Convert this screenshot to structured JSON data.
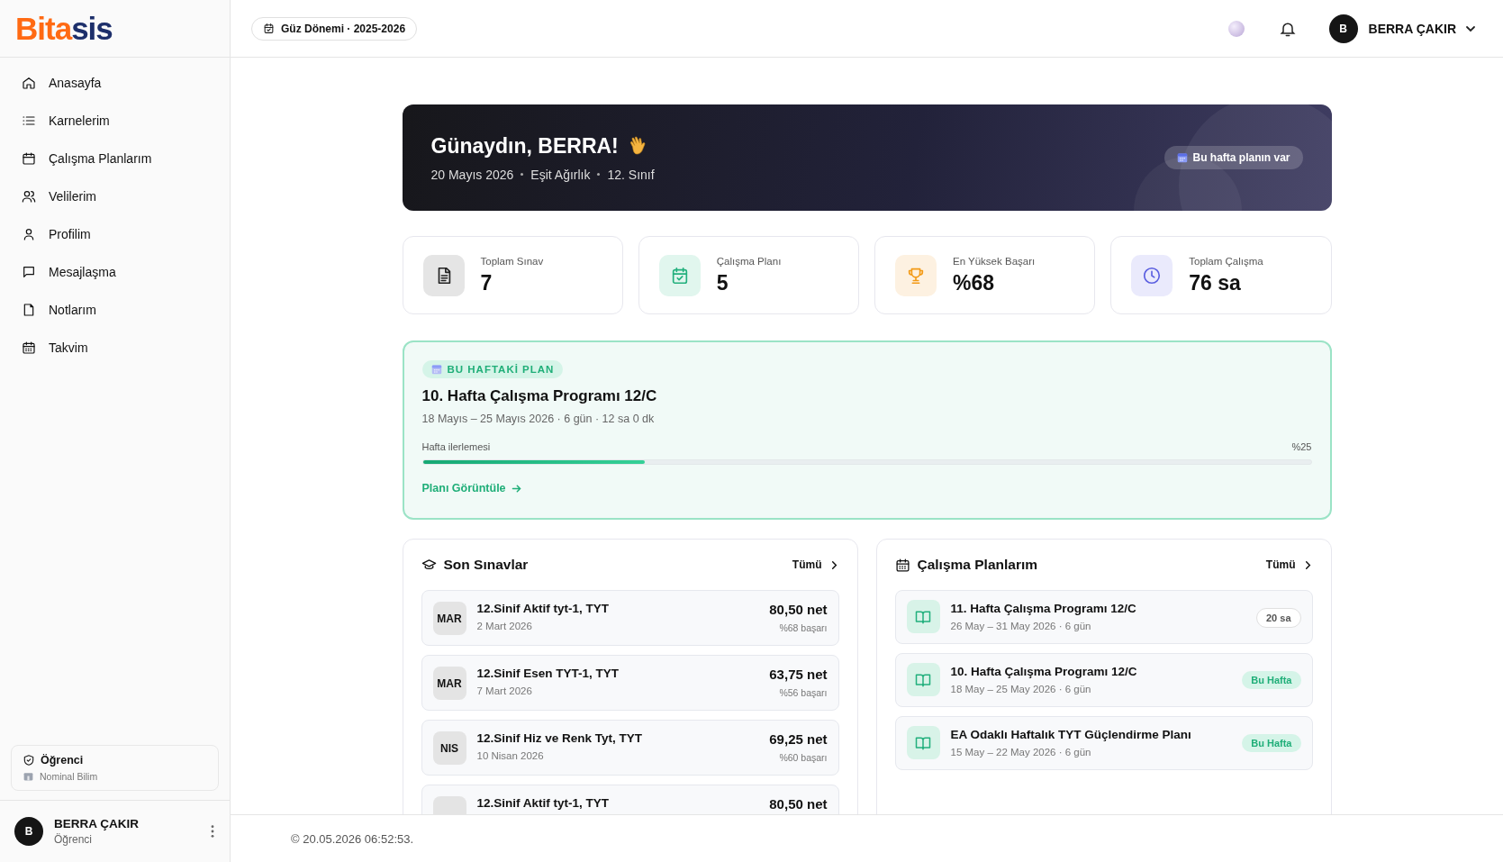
{
  "logo": {
    "first": "Bita",
    "second": "sis"
  },
  "nav": [
    {
      "label": "Anasayfa",
      "kind": "home"
    },
    {
      "label": "Karnelerim",
      "kind": "list"
    },
    {
      "label": "Çalışma Planlarım",
      "kind": "calendar"
    },
    {
      "label": "Velilerim",
      "kind": "users"
    },
    {
      "label": "Profilim",
      "kind": "user"
    },
    {
      "label": "Mesajlaşma",
      "kind": "message"
    },
    {
      "label": "Notlarım",
      "kind": "note"
    },
    {
      "label": "Takvim",
      "kind": "grid-calendar"
    }
  ],
  "role_card": {
    "role": "Öğrenci",
    "institution": "Nominal Bilim"
  },
  "sidebar_user": {
    "initial": "B",
    "name": "BERRA ÇAKIR",
    "role": "Öğrenci"
  },
  "header": {
    "term": "Güz Dönemi · 2025-2026",
    "initial": "B",
    "user": "BERRA ÇAKIR"
  },
  "hero": {
    "greeting": "Günaydın, BERRA!",
    "meta": [
      "20 Mayıs 2026",
      "Eşit Ağırlık",
      "12. Sınıf"
    ],
    "badge": "Bu hafta planın var"
  },
  "stats": [
    {
      "kind": "doc",
      "label": "Toplam Sınav",
      "value": "7"
    },
    {
      "kind": "plan",
      "label": "Çalışma Planı",
      "value": "5"
    },
    {
      "kind": "trophy",
      "label": "En Yüksek Başarı",
      "value": "%68"
    },
    {
      "kind": "clock",
      "label": "Toplam Çalışma",
      "value": "76 sa"
    }
  ],
  "week_plan": {
    "badge": "BU HAFTAKİ PLAN",
    "title": "10. Hafta Çalışma Programı 12/C",
    "meta": "18 Mayıs – 25 Mayıs 2026 · 6 gün · 12 sa 0 dk",
    "progress_label": "Hafta ilerlemesi",
    "progress_text": "%25",
    "level": 0.25,
    "link": "Planı Görüntüle"
  },
  "exams": {
    "title": "Son Sınavlar",
    "all": "Tümü",
    "items": [
      {
        "month": "MAR",
        "title": "12.Sinif Aktif tyt-1, TYT",
        "date": "2 Mart 2026",
        "net": "80,50 net",
        "success": "%68 başarı"
      },
      {
        "month": "MAR",
        "title": "12.Sinif Esen TYT-1, TYT",
        "date": "7 Mart 2026",
        "net": "63,75 net",
        "success": "%56 başarı"
      },
      {
        "month": "NIS",
        "title": "12.Sinif Hiz ve Renk Tyt, TYT",
        "date": "10 Nisan 2026",
        "net": "69,25 net",
        "success": "%60 başarı"
      },
      {
        "title": "12.Sinif Aktif tyt-1, TYT",
        "net": "80,50 net"
      }
    ]
  },
  "plans": {
    "title": "Çalışma Planlarım",
    "all": "Tümü",
    "items": [
      {
        "title": "11. Hafta Çalışma Programı 12/C",
        "meta": "26 May – 31 May 2026 · 6 gün",
        "kind": "hours",
        "tag": "20 sa"
      },
      {
        "title": "10. Hafta Çalışma Programı 12/C",
        "meta": "18 May – 25 May 2026 · 6 gün",
        "kind": "current",
        "tag": "Bu Hafta"
      },
      {
        "title": "EA Odaklı Haftalık TYT Güçlendirme Planı",
        "meta": "15 May – 22 May 2026 · 6 gün",
        "kind": "current",
        "tag": "Bu Hafta"
      }
    ]
  },
  "footer": "© 20.05.2026 06:52:53."
}
